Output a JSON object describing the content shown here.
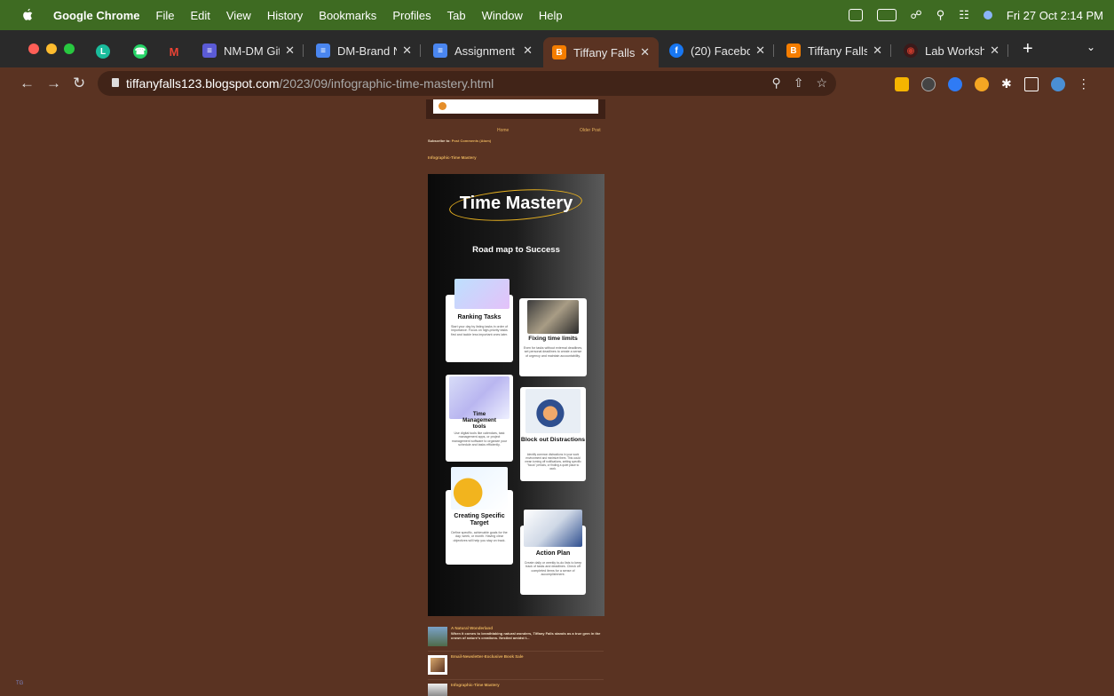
{
  "menubar": {
    "app_name": "Google Chrome",
    "items": [
      "File",
      "Edit",
      "View",
      "History",
      "Bookmarks",
      "Profiles",
      "Tab",
      "Window",
      "Help"
    ],
    "clock": "Fri 27 Oct  2:14 PM"
  },
  "tabs": [
    {
      "label": "NM-DM Git",
      "favicon": "list-icon",
      "color": "#5b5bd6"
    },
    {
      "label": "DM-Brand N",
      "favicon": "docs-icon",
      "color": "#4a86f0"
    },
    {
      "label": "Assignment",
      "favicon": "docs-icon",
      "color": "#4a86f0"
    },
    {
      "label": "Tiffany Falls",
      "favicon": "blogger-icon",
      "color": "#f57d00"
    },
    {
      "label": "(20) Facebo",
      "favicon": "facebook-icon",
      "color": "#1877f2"
    },
    {
      "label": "Tiffany Falls",
      "favicon": "blogger-icon",
      "color": "#f57d00"
    },
    {
      "label": "Lab Worksh",
      "favicon": "circle-icon",
      "color": "#c0392b"
    }
  ],
  "address_bar": {
    "host": "tiffanyfalls123.blogspot.com",
    "path": "/2023/09/infographic-time-mastery.html"
  },
  "blog": {
    "home_label": "Home",
    "older_label": "Older Post",
    "subscribe_prefix": "Subscribe to:",
    "subscribe_link": "Post Comments (Atom)",
    "post_title_link": "Infographic-Time Mastery"
  },
  "infographic": {
    "title": "Time Mastery",
    "subtitle": "Road map to Success",
    "cards": [
      {
        "title": "Ranking Tasks",
        "text": "Start your day by listing tasks in order of importance. Focus on high-priority tasks first and tackle less important ones later."
      },
      {
        "title": "Fixing time limits",
        "text": "Even for tasks without external deadlines, set personal deadlines to create a sense of urgency and maintain accountability."
      },
      {
        "title": "Time Management tools",
        "text": "Use digital tools like calendars, task management apps, or project management software to organize your schedule and tasks efficiently."
      },
      {
        "title": "Block out Distractions",
        "text": "Identify common distractions in your work environment and minimize them. This could mean turning off notifications, setting specific \"focus\" periods, or finding a quiet place to work."
      },
      {
        "title": "Creating Specific Target",
        "text": "Define specific, achievable goals for the day, week, or month. Having clear objectives will help you stay on track."
      },
      {
        "title": "Action Plan",
        "text": "Create daily or weekly to-do lists to keep track of tasks and deadlines. Check off completed items for a sense of accomplishment."
      }
    ]
  },
  "related_posts": [
    {
      "title": "A Natural Wonderland",
      "snippet": "When it comes to breathtaking natural wonders, Tiffany Falls stands as a true gem in the crown of nature's creations. Nestled amidst t..."
    },
    {
      "title": "Email-Newsletter-Exclusive Book Sale",
      "snippet": ""
    },
    {
      "title": "Infographic-Time Mastery",
      "snippet": ""
    }
  ],
  "corner_badge": "TG"
}
